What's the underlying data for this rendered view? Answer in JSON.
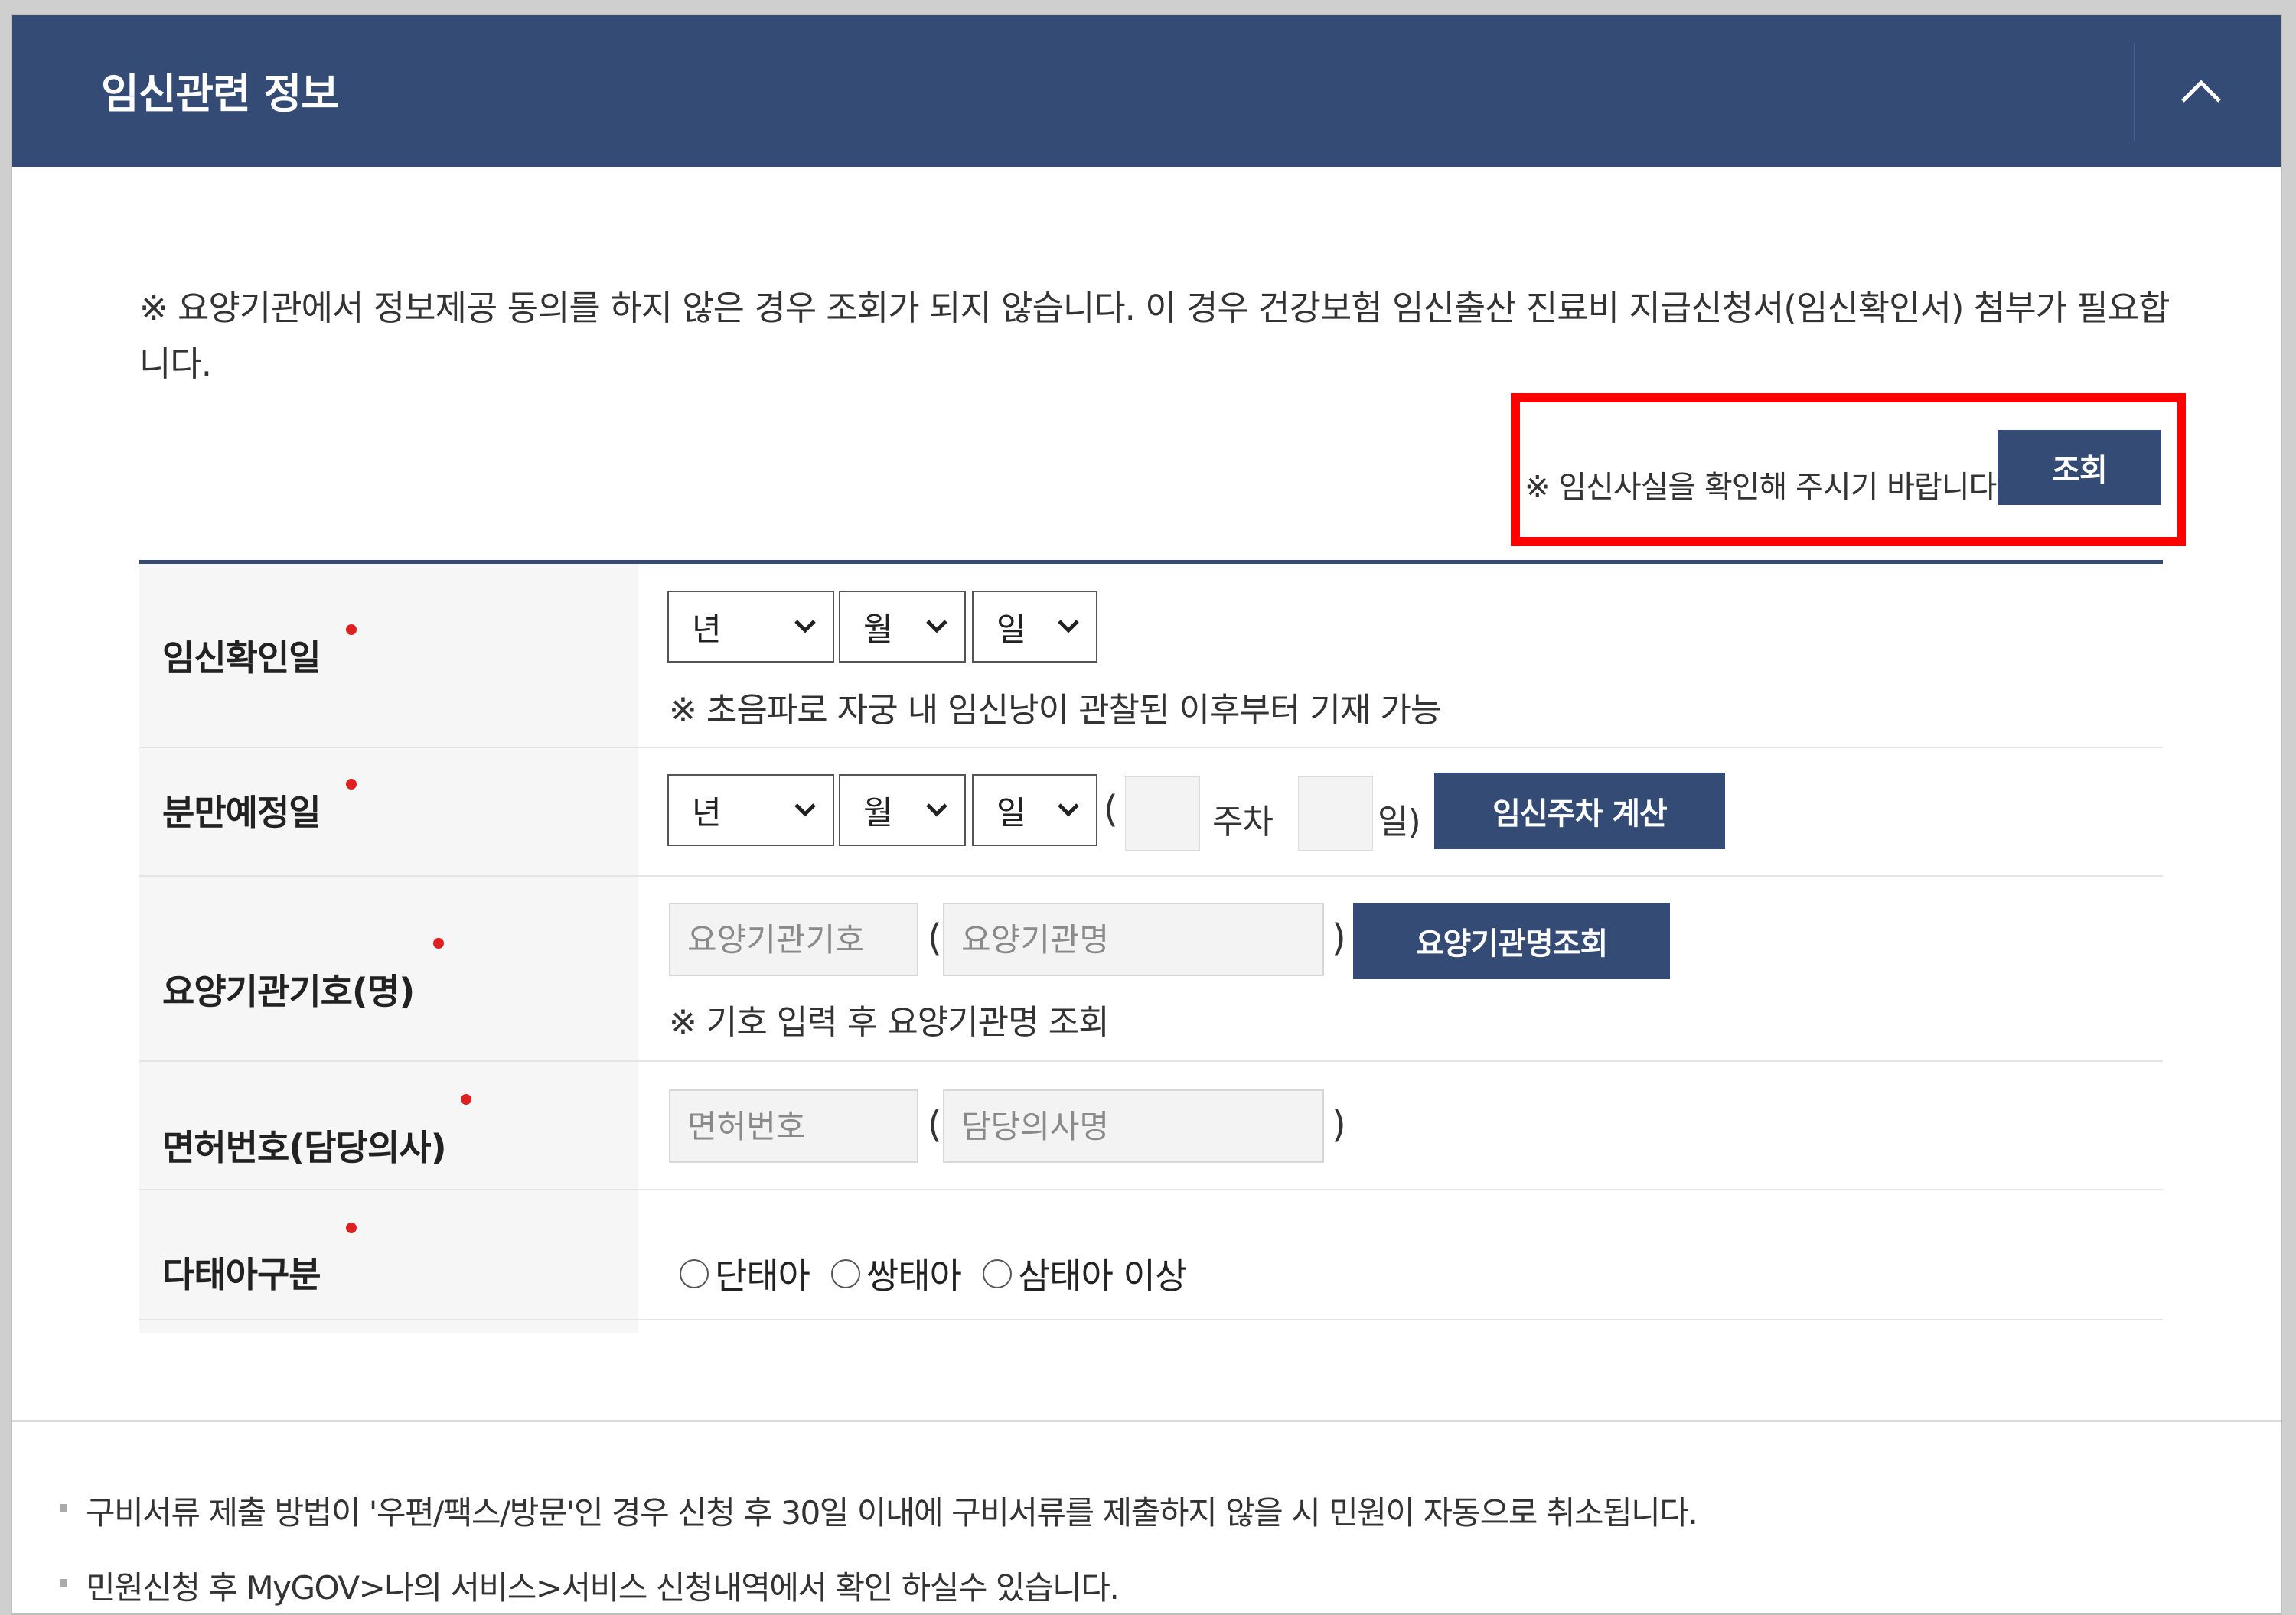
{
  "header": {
    "title": "임신관련 정보"
  },
  "notice": "※ 요양기관에서 정보제공 동의를 하지 않은 경우 조회가 되지 않습니다. 이 경우 건강보험 임신출산 진료비 지급신청서(임신확인서) 첨부가 필요합니다.",
  "check": {
    "message": "※ 임신사실을 확인해 주시기 바랍니다.",
    "button_label": "조회"
  },
  "colors": {
    "primary": "#344b75",
    "required": "#e02020",
    "highlight": "#ff0000"
  },
  "form": {
    "pregnancy_date": {
      "label": "임신확인일",
      "year": "년",
      "month": "월",
      "day": "일",
      "hint": "※ 초음파로 자궁 내 임신낭이 관찰된 이후부터 기재 가능"
    },
    "due_date": {
      "label": "분만예정일",
      "year": "년",
      "month": "월",
      "day": "일",
      "open_paren": "(",
      "week_unit": "주차",
      "day_unit": "일)",
      "calc_button": "임신주차 계산"
    },
    "institution": {
      "label": "요양기관기호(명)",
      "code_placeholder": "요양기관기호",
      "open_paren": "(",
      "name_placeholder": "요양기관명",
      "close_paren": ")",
      "search_button": "요양기관명조회",
      "hint": "※ 기호 입력 후 요양기관명 조회"
    },
    "license": {
      "label": "면허번호(담당의사)",
      "number_placeholder": "면허번호",
      "open_paren": "(",
      "doctor_placeholder": "담당의사명",
      "close_paren": ")"
    },
    "multiple": {
      "label": "다태아구분",
      "options": [
        "단태아",
        "쌍태아",
        "삼태아 이상"
      ]
    }
  },
  "footnotes": [
    "구비서류 제출 방법이 '우편/팩스/방문'인 경우 신청 후 30일 이내에 구비서류를 제출하지 않을 시 민원이 자동으로 취소됩니다.",
    "민원신청 후 MyGOV>나의 서비스>서비스 신청내역에서 확인 하실수 있습니다."
  ],
  "icons": {
    "collapse": "chevron-up-icon",
    "dropdown": "chevron-down-icon"
  }
}
